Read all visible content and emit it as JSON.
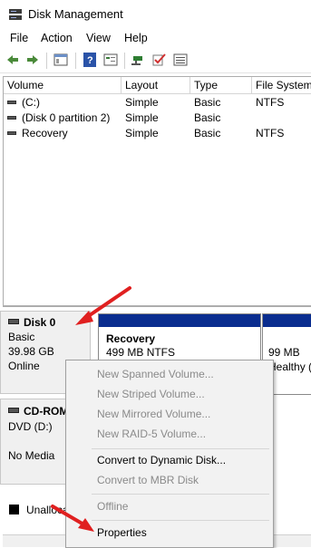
{
  "window": {
    "title": "Disk Management"
  },
  "menu": [
    "File",
    "Action",
    "View",
    "Help"
  ],
  "toolbar": {
    "buttons": [
      "back-icon",
      "forward-icon",
      "show-hide-console-tree-icon",
      "help-icon",
      "properties-icon",
      "connect-icon",
      "check-icon",
      "list-icon"
    ]
  },
  "volume_list": {
    "columns": [
      "Volume",
      "Layout",
      "Type",
      "File System"
    ],
    "rows": [
      {
        "volume": "(C:)",
        "layout": "Simple",
        "type": "Basic",
        "fs": "NTFS"
      },
      {
        "volume": "(Disk 0 partition 2)",
        "layout": "Simple",
        "type": "Basic",
        "fs": ""
      },
      {
        "volume": "Recovery",
        "layout": "Simple",
        "type": "Basic",
        "fs": "NTFS"
      }
    ]
  },
  "disks": [
    {
      "name": "Disk 0",
      "type": "Basic",
      "size": "39.98 GB",
      "status": "Online"
    },
    {
      "name": "CD-ROM",
      "type_label": "DVD (D:)",
      "status": "No Media"
    }
  ],
  "partitions": [
    {
      "name": "Recovery",
      "detail": "499 MB NTFS"
    },
    {
      "size": "99 MB",
      "status": "Healthy ("
    }
  ],
  "legend": {
    "unallocated": "Unalloca"
  },
  "context_menu": {
    "items": [
      {
        "label": "New Spanned Volume...",
        "enabled": false
      },
      {
        "label": "New Striped Volume...",
        "enabled": false
      },
      {
        "label": "New Mirrored Volume...",
        "enabled": false
      },
      {
        "label": "New RAID-5 Volume...",
        "enabled": false
      },
      {
        "label": "Convert to Dynamic Disk...",
        "enabled": true
      },
      {
        "label": "Convert to MBR Disk",
        "enabled": false
      },
      {
        "label": "Offline",
        "enabled": false
      },
      {
        "label": "Properties",
        "enabled": true
      }
    ]
  },
  "colors": {
    "partition_header": "#0a2d8f",
    "annotation_arrow": "#e02020"
  }
}
